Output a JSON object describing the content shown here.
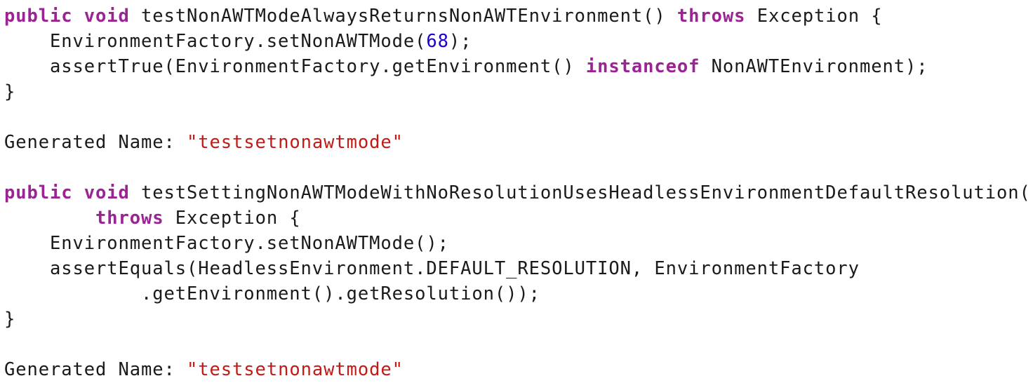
{
  "lines": [
    [
      {
        "t": "public",
        "k": "kw"
      },
      {
        "t": " ",
        "k": "plain"
      },
      {
        "t": "void",
        "k": "kw"
      },
      {
        "t": " testNonAWTModeAlwaysReturnsNonAWTEnvironment() ",
        "k": "plain"
      },
      {
        "t": "throws",
        "k": "kw"
      },
      {
        "t": " Exception {",
        "k": "plain"
      }
    ],
    [
      {
        "t": "    EnvironmentFactory.setNonAWTMode(",
        "k": "plain"
      },
      {
        "t": "68",
        "k": "num"
      },
      {
        "t": ");",
        "k": "plain"
      }
    ],
    [
      {
        "t": "    assertTrue(EnvironmentFactory.getEnvironment() ",
        "k": "plain"
      },
      {
        "t": "instanceof",
        "k": "kw"
      },
      {
        "t": " NonAWTEnvironment);",
        "k": "plain"
      }
    ],
    [
      {
        "t": "}",
        "k": "plain"
      }
    ],
    [],
    [
      {
        "t": "Generated Name: ",
        "k": "plain"
      },
      {
        "t": "\"testsetnonawtmode\"",
        "k": "str"
      }
    ],
    [],
    [
      {
        "t": "public",
        "k": "kw"
      },
      {
        "t": " ",
        "k": "plain"
      },
      {
        "t": "void",
        "k": "kw"
      },
      {
        "t": " testSettingNonAWTModeWithNoResolutionUsesHeadlessEnvironmentDefaultResolution()",
        "k": "plain"
      }
    ],
    [
      {
        "t": "        ",
        "k": "plain"
      },
      {
        "t": "throws",
        "k": "kw"
      },
      {
        "t": " Exception {",
        "k": "plain"
      }
    ],
    [
      {
        "t": "    EnvironmentFactory.setNonAWTMode();",
        "k": "plain"
      }
    ],
    [
      {
        "t": "    assertEquals(HeadlessEnvironment.DEFAULT_RESOLUTION, EnvironmentFactory",
        "k": "plain"
      }
    ],
    [
      {
        "t": "            .getEnvironment().getResolution());",
        "k": "plain"
      }
    ],
    [
      {
        "t": "}",
        "k": "plain"
      }
    ],
    [],
    [
      {
        "t": "Generated Name: ",
        "k": "plain"
      },
      {
        "t": "\"testsetnonawtmode\"",
        "k": "str"
      }
    ]
  ],
  "colors": {
    "keyword": "#9b2393",
    "number": "#1c00cf",
    "string": "#c41a16",
    "text": "#1a1a1a",
    "background": "#ffffff"
  }
}
